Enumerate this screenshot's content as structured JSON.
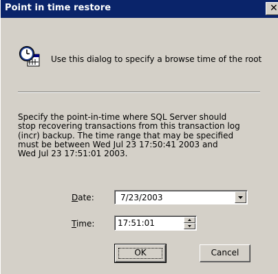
{
  "window": {
    "title": "Point in time restore",
    "close_glyph": "✕"
  },
  "intro": {
    "icon": "clock-calendar-icon",
    "text": "Use this dialog to specify a browse time of the root"
  },
  "description": {
    "lines": [
      "Specify the point-in-time where SQL Server should",
      "stop recovering transactions from this transaction log",
      "(incr) backup.  The time range that may be specified",
      "must be between Wed Jul 23 17:50:41 2003 and",
      "Wed Jul 23 17:51:01 2003."
    ]
  },
  "form": {
    "date_label_accel": "D",
    "date_label_rest": "ate:",
    "date_value": "7/23/2003",
    "time_label_accel": "T",
    "time_label_rest": "ime:",
    "time_value": "17:51:01"
  },
  "buttons": {
    "ok_label": "OK",
    "cancel_label": "Cancel"
  },
  "colors": {
    "titlebar": "#0a246a",
    "face": "#d4d0c8"
  }
}
